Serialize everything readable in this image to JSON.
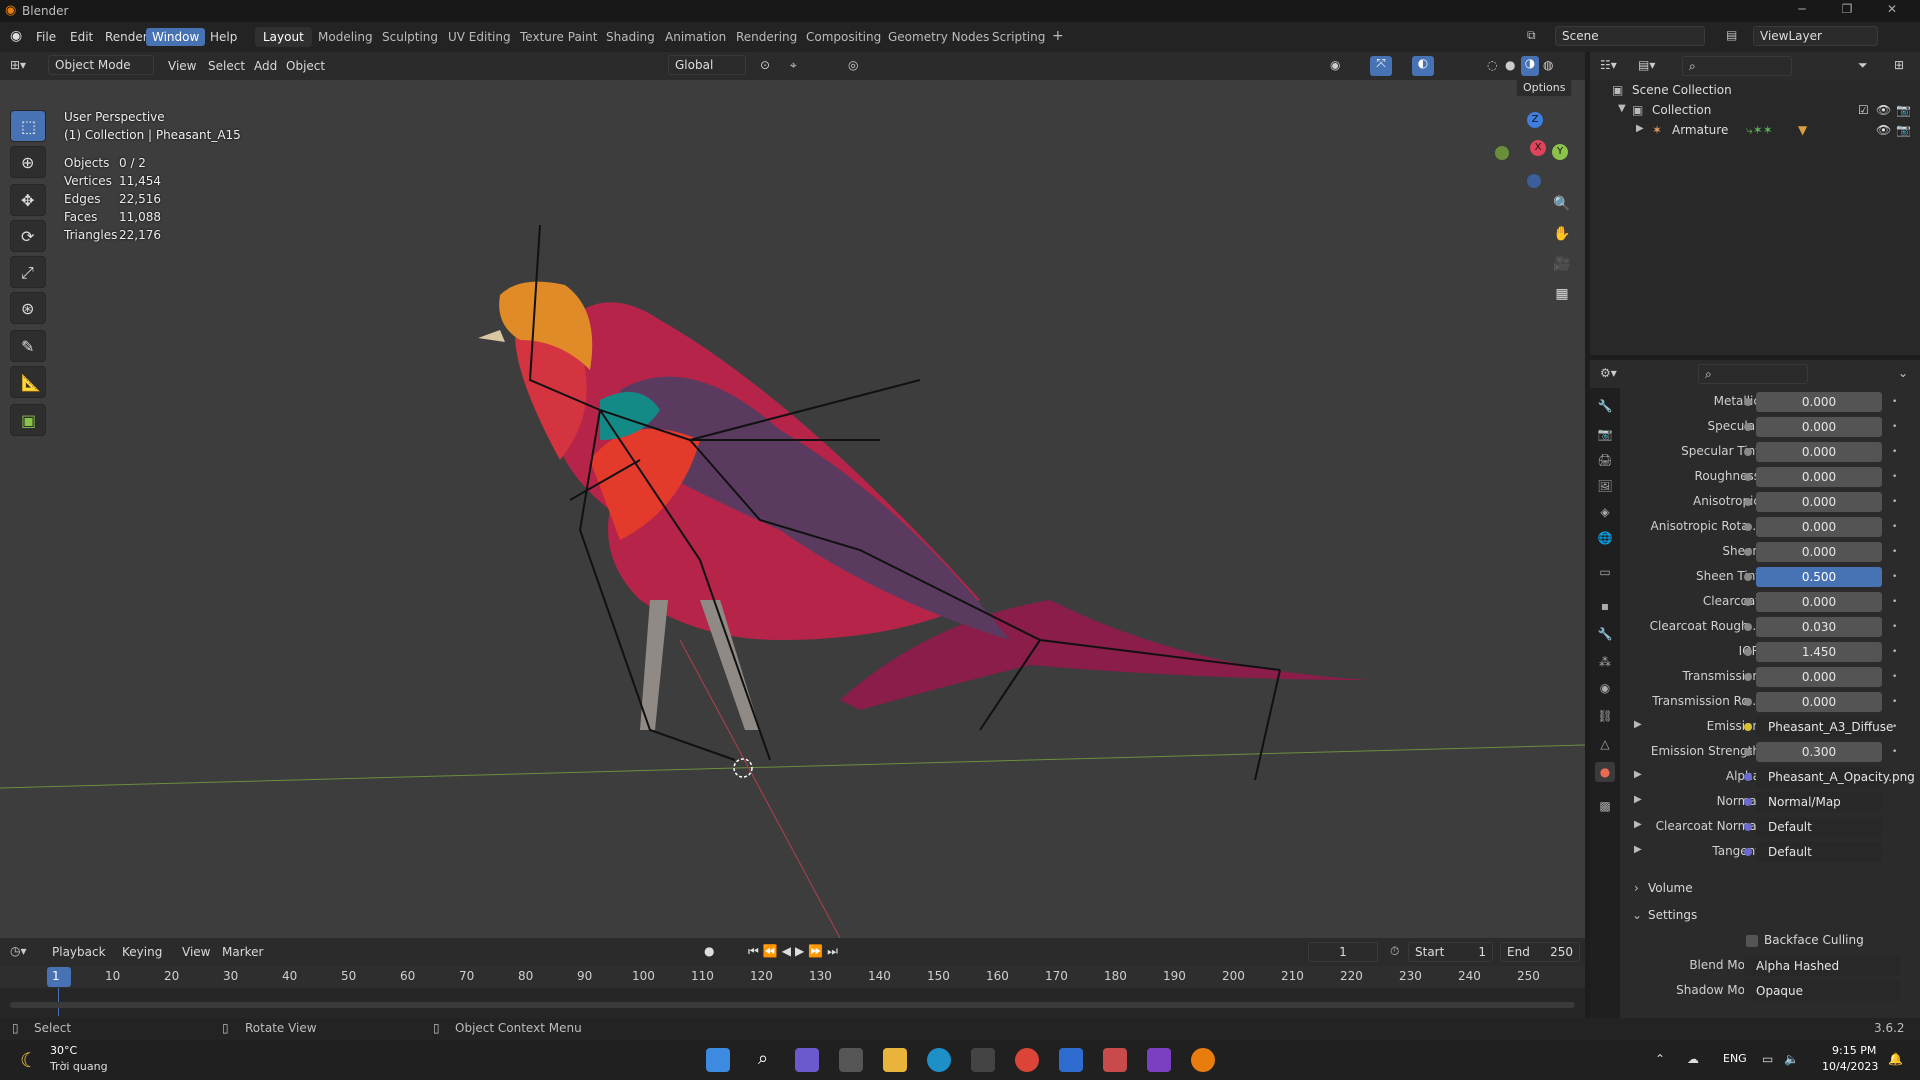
{
  "app": {
    "title": "Blender",
    "version": "3.6.2"
  },
  "menu": {
    "file": "File",
    "edit": "Edit",
    "render": "Render",
    "window": "Window",
    "help": "Help"
  },
  "workspaces": [
    "Layout",
    "Modeling",
    "Sculpting",
    "UV Editing",
    "Texture Paint",
    "Shading",
    "Animation",
    "Rendering",
    "Compositing",
    "Geometry Nodes",
    "Scripting"
  ],
  "scene": {
    "name": "Scene",
    "view_layer": "ViewLayer"
  },
  "viewport_header": {
    "mode": "Object Mode",
    "view": "View",
    "select": "Select",
    "add": "Add",
    "object": "Object",
    "orientation": "Global",
    "options": "Options"
  },
  "viewport": {
    "perspective": "User Perspective",
    "collection_line": "(1) Collection | Pheasant_A15",
    "stats": [
      {
        "label": "Objects",
        "value": "0 / 2"
      },
      {
        "label": "Vertices",
        "value": "11,454"
      },
      {
        "label": "Edges",
        "value": "22,516"
      },
      {
        "label": "Faces",
        "value": "11,088"
      },
      {
        "label": "Triangles",
        "value": "22,176"
      }
    ],
    "gizmo": {
      "x": "X",
      "y": "Y",
      "z": "Z"
    }
  },
  "timeline": {
    "playback": "Playback",
    "keying": "Keying",
    "view": "View",
    "marker": "Marker",
    "current_frame": "1",
    "start_label": "Start",
    "start": "1",
    "end_label": "End",
    "end": "250",
    "ticks": [
      "1",
      "10",
      "20",
      "30",
      "40",
      "50",
      "60",
      "70",
      "80",
      "90",
      "100",
      "110",
      "120",
      "130",
      "140",
      "150",
      "160",
      "170",
      "180",
      "190",
      "200",
      "210",
      "220",
      "230",
      "240",
      "250"
    ]
  },
  "statusbar": {
    "select": "Select",
    "rotate": "Rotate View",
    "context": "Object Context Menu",
    "version": "3.6.2"
  },
  "outliner": {
    "scene_collection": "Scene Collection",
    "collection": "Collection",
    "armature": "Armature"
  },
  "properties": {
    "rows": [
      {
        "label": "Metallic",
        "value": "0.000",
        "kind": "num"
      },
      {
        "label": "Specular",
        "value": "0.000",
        "kind": "num"
      },
      {
        "label": "Specular Tint",
        "value": "0.000",
        "kind": "num"
      },
      {
        "label": "Roughness",
        "value": "0.000",
        "kind": "num"
      },
      {
        "label": "Anisotropic",
        "value": "0.000",
        "kind": "num"
      },
      {
        "label": "Anisotropic Rota...",
        "value": "0.000",
        "kind": "num"
      },
      {
        "label": "Sheen",
        "value": "0.000",
        "kind": "num"
      },
      {
        "label": "Sheen Tint",
        "value": "0.500",
        "kind": "hl"
      },
      {
        "label": "Clearcoat",
        "value": "0.000",
        "kind": "num"
      },
      {
        "label": "Clearcoat Rough...",
        "value": "0.030",
        "kind": "num"
      },
      {
        "label": "IOR",
        "value": "1.450",
        "kind": "num"
      },
      {
        "label": "Transmission",
        "value": "0.000",
        "kind": "num"
      },
      {
        "label": "Transmission Ro...",
        "value": "0.000",
        "kind": "num"
      },
      {
        "label": "Emission",
        "value": "Pheasant_A3_Diffuse",
        "kind": "link"
      },
      {
        "label": "Emission Strength",
        "value": "0.300",
        "kind": "num"
      },
      {
        "label": "Alpha",
        "value": "Pheasant_A_Opacity.png",
        "kind": "link"
      },
      {
        "label": "Normal",
        "value": "Normal/Map",
        "kind": "link"
      },
      {
        "label": "Clearcoat Normal",
        "value": "Default",
        "kind": "link"
      },
      {
        "label": "Tangent",
        "value": "Default",
        "kind": "link"
      }
    ],
    "volume": "Volume",
    "settings": "Settings",
    "backface": "Backface Culling",
    "blend_mode_label": "Blend Mode",
    "blend_mode": "Alpha Hashed",
    "shadow_mode_label": "Shadow Mode",
    "shadow_mode": "Opaque"
  },
  "taskbar": {
    "temp": "30°C",
    "weather": "Trời quang",
    "lang": "ENG",
    "time": "9:15 PM",
    "date": "10/4/2023"
  },
  "colors": {
    "accent": "#4772b3",
    "header": "#2b2b2b",
    "viewport": "#3d3d3d",
    "x_axis": "#e0445c",
    "y_axis": "#8bc34a",
    "z_axis": "#3d7ee0"
  }
}
